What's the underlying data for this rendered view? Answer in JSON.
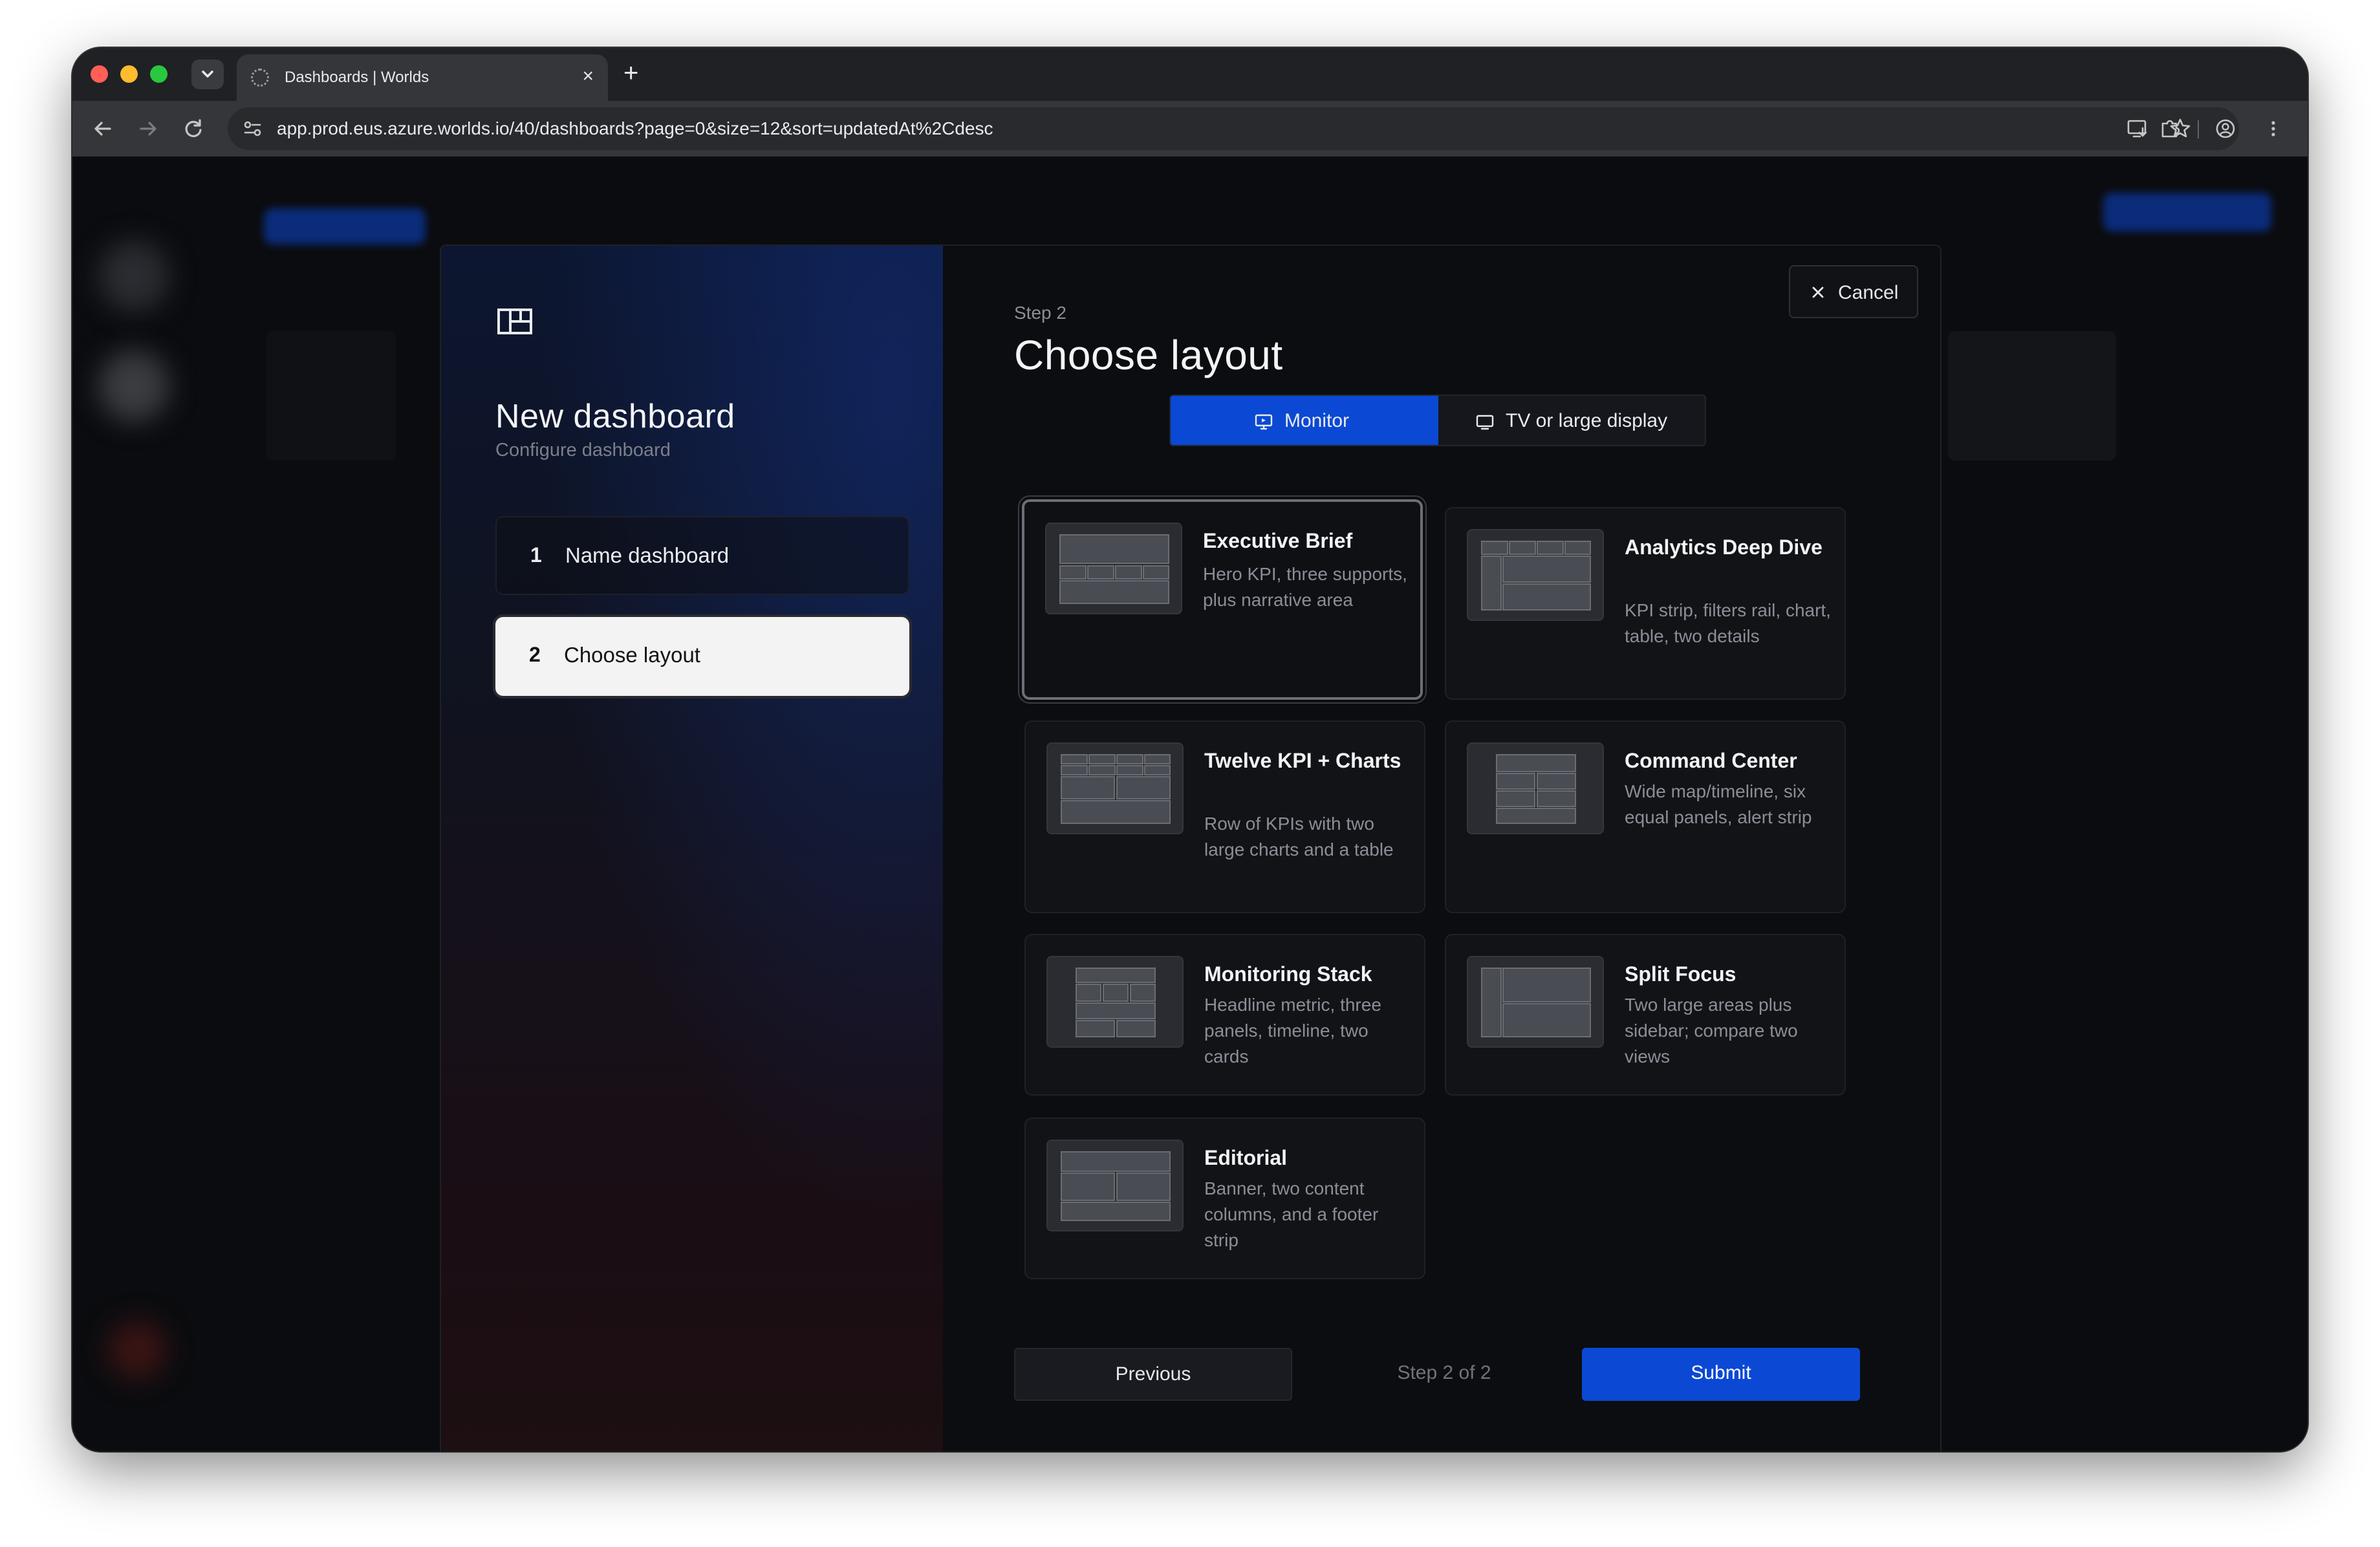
{
  "browser": {
    "tab_title": "Dashboards | Worlds",
    "url": "app.prod.eus.azure.worlds.io/40/dashboards?page=0&size=12&sort=updatedAt%2Cdesc"
  },
  "wizard": {
    "title": "New dashboard",
    "subtitle": "Configure dashboard",
    "steps": [
      {
        "number": "1",
        "label": "Name dashboard",
        "active": false
      },
      {
        "number": "2",
        "label": "Choose layout",
        "active": true
      }
    ]
  },
  "content": {
    "cancel_label": "Cancel",
    "eyebrow": "Step 2",
    "title": "Choose layout",
    "display_options": [
      {
        "label": "Monitor",
        "icon": "monitor-icon",
        "selected": true
      },
      {
        "label": "TV or large display",
        "icon": "tv-icon",
        "selected": false
      }
    ],
    "layouts": [
      {
        "title": "Executive Brief",
        "description": "Hero KPI, three supports, plus narrative area",
        "selected": true
      },
      {
        "title": "Analytics Deep Dive",
        "description": "KPI strip, filters rail, chart, table, two details",
        "selected": false
      },
      {
        "title": "Twelve KPI + Charts",
        "description": "Row of KPIs with two large charts and a table",
        "selected": false
      },
      {
        "title": "Command Center",
        "description": "Wide map/timeline, six equal panels, alert strip",
        "selected": false
      },
      {
        "title": "Monitoring Stack",
        "description": "Headline metric, three panels, timeline, two cards",
        "selected": false
      },
      {
        "title": "Split Focus",
        "description": "Two large areas plus sidebar; compare two views",
        "selected": false
      },
      {
        "title": "Editorial",
        "description": "Banner, two content columns, and a footer strip",
        "selected": false
      }
    ],
    "footer": {
      "previous_label": "Previous",
      "step_indicator": "Step 2 of 2",
      "submit_label": "Submit"
    }
  },
  "colors": {
    "accent": "#0b49d4",
    "modal_bg": "#0c0d10",
    "selected_step_bg": "#f3f3f4"
  }
}
